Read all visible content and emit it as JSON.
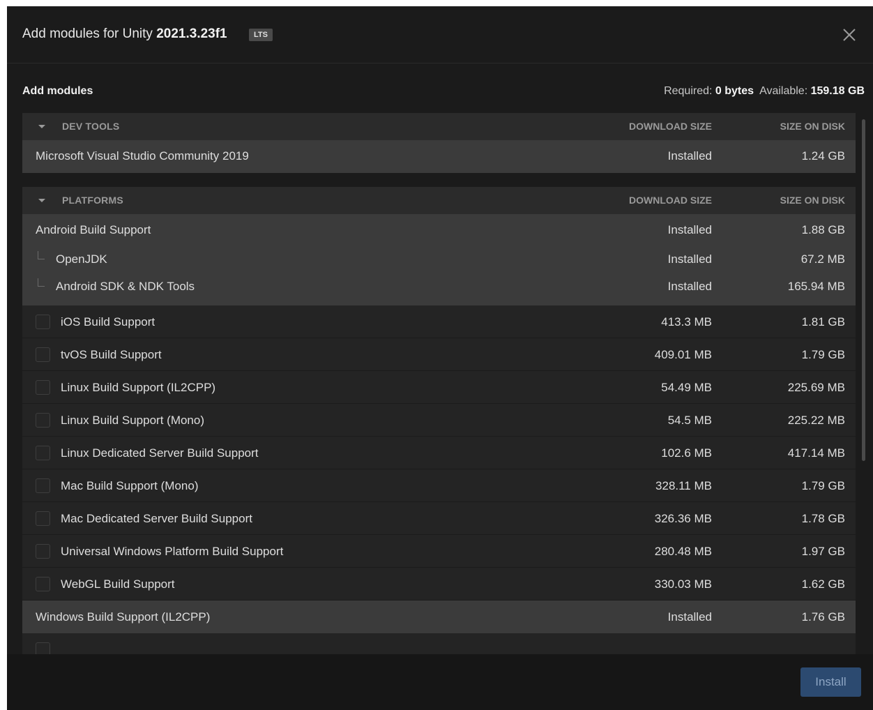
{
  "dialog": {
    "title_prefix": "Add modules for Unity ",
    "version": "2021.3.23f1",
    "badge": "LTS",
    "close_icon": "close-icon"
  },
  "summary": {
    "heading": "Add modules",
    "required_label": "Required:",
    "required_value": "0 bytes",
    "available_label": "Available:",
    "available_value": "159.18 GB"
  },
  "dev_tools": {
    "title": "DEV TOOLS",
    "col_download": "DOWNLOAD SIZE",
    "col_disk": "SIZE ON DISK",
    "rows": [
      {
        "name": "Microsoft Visual Studio Community 2019",
        "download": "Installed",
        "disk": "1.24 GB"
      }
    ]
  },
  "platforms": {
    "title": "PLATFORMS",
    "col_download": "DOWNLOAD SIZE",
    "col_disk": "SIZE ON DISK",
    "android": {
      "name": "Android Build Support",
      "download": "Installed",
      "disk": "1.88 GB"
    },
    "android_children": [
      {
        "name": "OpenJDK",
        "download": "Installed",
        "disk": "67.2 MB"
      },
      {
        "name": "Android SDK & NDK Tools",
        "download": "Installed",
        "disk": "165.94 MB"
      }
    ],
    "options": [
      {
        "name": "iOS Build Support",
        "download": "413.3 MB",
        "disk": "1.81 GB"
      },
      {
        "name": "tvOS Build Support",
        "download": "409.01 MB",
        "disk": "1.79 GB"
      },
      {
        "name": "Linux Build Support (IL2CPP)",
        "download": "54.49 MB",
        "disk": "225.69 MB"
      },
      {
        "name": "Linux Build Support (Mono)",
        "download": "54.5 MB",
        "disk": "225.22 MB"
      },
      {
        "name": "Linux Dedicated Server Build Support",
        "download": "102.6 MB",
        "disk": "417.14 MB"
      },
      {
        "name": "Mac Build Support (Mono)",
        "download": "328.11 MB",
        "disk": "1.79 GB"
      },
      {
        "name": "Mac Dedicated Server Build Support",
        "download": "326.36 MB",
        "disk": "1.78 GB"
      },
      {
        "name": "Universal Windows Platform Build Support",
        "download": "280.48 MB",
        "disk": "1.97 GB"
      },
      {
        "name": "WebGL Build Support",
        "download": "330.03 MB",
        "disk": "1.62 GB"
      }
    ],
    "windows": {
      "name": "Windows Build Support (IL2CPP)",
      "download": "Installed",
      "disk": "1.76 GB"
    }
  },
  "footer": {
    "install_label": "Install"
  },
  "colors": {
    "background": "#1b1b1b",
    "section_header": "#2b2b2b",
    "installed_row": "#3b3b3b",
    "install_button": "#2c4a70"
  }
}
